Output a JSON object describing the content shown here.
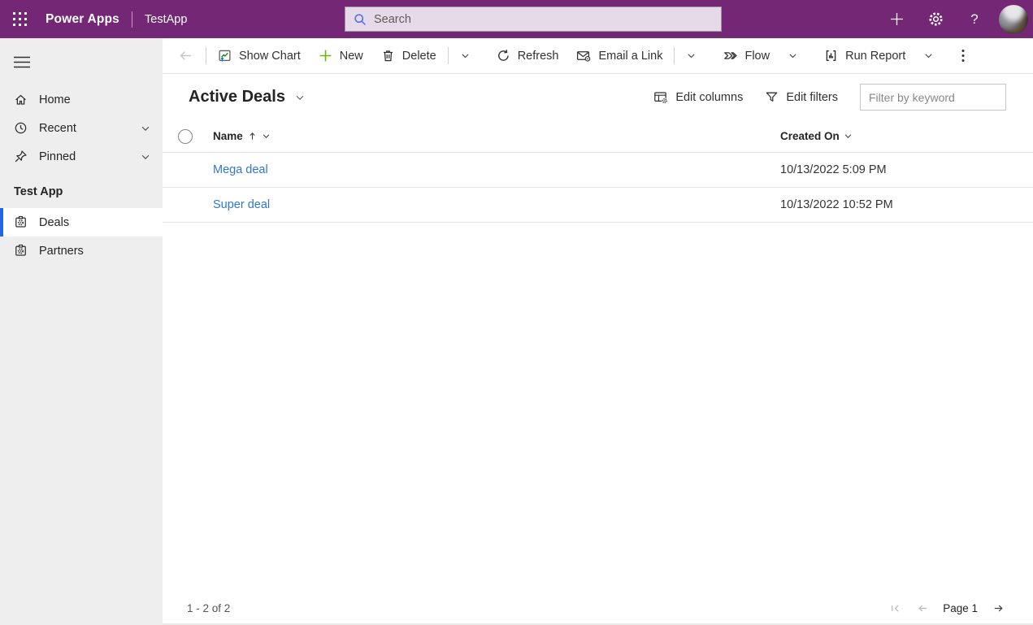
{
  "topbar": {
    "brand": "Power Apps",
    "app_name": "TestApp",
    "search_placeholder": "Search",
    "help_glyph": "?",
    "colors": {
      "bar_bg": "#742774",
      "search_fill": "#e7dae8",
      "search_icon": "#4f6bed"
    }
  },
  "command_bar": {
    "show_chart": "Show Chart",
    "new": "New",
    "delete": "Delete",
    "refresh": "Refresh",
    "email_link": "Email a Link",
    "flow": "Flow",
    "run_report": "Run Report"
  },
  "sidebar": {
    "items": [
      {
        "label": "Home",
        "collapsible": false
      },
      {
        "label": "Recent",
        "collapsible": true
      },
      {
        "label": "Pinned",
        "collapsible": true
      }
    ],
    "section_title": "Test App",
    "entities": [
      {
        "label": "Deals",
        "selected": true
      },
      {
        "label": "Partners",
        "selected": false
      }
    ],
    "colors": {
      "bg": "#efeeee",
      "selected_indicator": "#2266e3"
    }
  },
  "view": {
    "title": "Active Deals",
    "edit_columns": "Edit columns",
    "edit_filters": "Edit filters",
    "filter_placeholder": "Filter by keyword"
  },
  "table": {
    "columns": [
      {
        "label": "Name",
        "sorted": "ascending"
      },
      {
        "label": "Created On",
        "sorted": null
      }
    ],
    "rows": [
      {
        "name": "Mega deal",
        "created_on": "10/13/2022 5:09 PM"
      },
      {
        "name": "Super deal",
        "created_on": "10/13/2022 10:52 PM"
      }
    ],
    "link_color": "#2e76d2"
  },
  "footer": {
    "record_range": "1 - 2 of 2",
    "page_label": "Page 1"
  },
  "icons": {
    "waffle-icon": "3x3 white dot grid",
    "search-icon": "magnifier",
    "add-icon": "plus",
    "settings-icon": "gear",
    "help-icon": "question mark",
    "hamburger-icon": "three lines",
    "home-icon": "house outline",
    "recent-icon": "clock outline",
    "pinned-icon": "pushpin outline",
    "entity-icon": "table badge with gear",
    "back-icon": "left arrow",
    "show-chart-icon": "boxed trend line green with blue arrow",
    "new-icon": "green plus",
    "delete-icon": "trash can outline",
    "refresh-icon": "circular arrow",
    "email-link-icon": "envelope",
    "flow-icon": "double chevron flow logo",
    "run-report-icon": "boxed bar chart",
    "overflow-icon": "vertical ellipsis",
    "chevron-down-icon": "chevron down",
    "edit-columns-icon": "table with gear",
    "edit-filters-icon": "funnel",
    "sort-asc-icon": "up arrow",
    "first-page-icon": "bar with left chevron",
    "prev-page-icon": "left arrow",
    "next-page-icon": "right arrow"
  }
}
